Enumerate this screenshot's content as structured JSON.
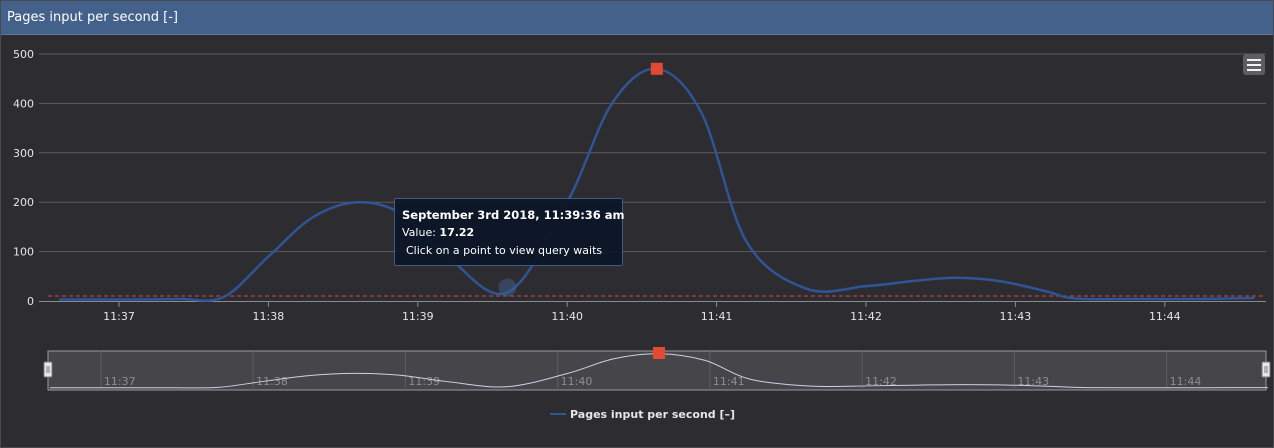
{
  "panel": {
    "title": "Pages input per second [-]"
  },
  "menu": {
    "icon": "hamburger-menu-icon"
  },
  "tooltip": {
    "title": "September 3rd 2018, 11:39:36 am",
    "value_label": "Value: ",
    "value": "17.22",
    "hint": "Click on a point to view query waits"
  },
  "colors": {
    "header": "#44618c",
    "series": "#2f5597",
    "marker": "#e34a33",
    "threshold": "#d04a4a",
    "background": "#2d2c30"
  },
  "chart_data": {
    "type": "line",
    "title": "",
    "xlabel": "",
    "ylabel": "",
    "y_ticks": [
      0,
      100,
      200,
      300,
      400,
      500
    ],
    "ylim": [
      0,
      500
    ],
    "x_ticks": [
      "11:37",
      "11:38",
      "11:39",
      "11:40",
      "11:41",
      "11:42",
      "11:43",
      "11:44"
    ],
    "grid": true,
    "threshold": 10,
    "series": [
      {
        "name": "Pages input per second [-]",
        "x_minutes": [
          36.6,
          37.0,
          37.4,
          37.7,
          38.0,
          38.3,
          38.6,
          38.9,
          39.2,
          39.6,
          40.0,
          40.3,
          40.6,
          40.9,
          41.2,
          41.6,
          42.0,
          42.3,
          42.6,
          42.9,
          43.2,
          43.4,
          43.8,
          44.2,
          44.6
        ],
        "x": [
          "11:36:36",
          "11:37:00",
          "11:37:24",
          "11:37:42",
          "11:38:00",
          "11:38:18",
          "11:38:36",
          "11:38:54",
          "11:39:12",
          "11:39:36",
          "11:40:00",
          "11:40:18",
          "11:40:36",
          "11:40:54",
          "11:41:12",
          "11:41:36",
          "11:42:00",
          "11:42:18",
          "11:42:36",
          "11:42:54",
          "11:43:12",
          "11:43:24",
          "11:43:48",
          "11:44:12",
          "11:44:36"
        ],
        "values": [
          3,
          3,
          4,
          8,
          90,
          170,
          200,
          175,
          90,
          17.22,
          200,
          400,
          470,
          380,
          120,
          25,
          30,
          40,
          47,
          40,
          20,
          5,
          4,
          4,
          6
        ],
        "highlight_index": 12
      }
    ],
    "navigator": {
      "x_ticks": [
        "11:37",
        "11:38",
        "11:39",
        "11:40",
        "11:41",
        "11:42",
        "11:43",
        "11:44"
      ]
    },
    "legend": {
      "position": "bottom-center",
      "label": "Pages input per second [–]"
    }
  }
}
